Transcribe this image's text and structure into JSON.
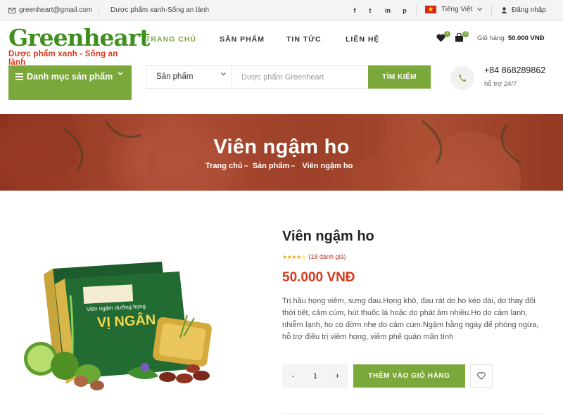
{
  "topbar": {
    "email": "greenheart@gmail.com",
    "slogan": "Dược phẩm xanh-Sống an lành",
    "social": [
      {
        "name": "facebook",
        "glyph": "f"
      },
      {
        "name": "twitter",
        "glyph": "t"
      },
      {
        "name": "linkedin",
        "glyph": "in"
      },
      {
        "name": "pinterest",
        "glyph": "p"
      }
    ],
    "language": "Tiếng Việt",
    "login": "Đăng nhập"
  },
  "logo": {
    "name": "Greenheart",
    "tagline": "Dược phẩm xanh - Sống an lành"
  },
  "nav": {
    "home": "TRANG CHỦ",
    "products": "SẢN PHẨM",
    "news": "TIN TỨC",
    "contact": "LIÊN HỆ"
  },
  "header": {
    "wishlist_count": "1",
    "cart_count": "3",
    "cart_label": "Giỏ hàng:",
    "cart_total": "50.000 VNĐ"
  },
  "category_menu": {
    "label": "Danh mục sản phẩm"
  },
  "search": {
    "category": "Sản phẩm",
    "placeholder": "Dược phẩm Greenheart",
    "button": "TÌM KIẾM"
  },
  "contact": {
    "phone": "+84 868289862",
    "support": "hỗ trợ 24/7"
  },
  "banner": {
    "title": "Viên ngậm ho",
    "breadcrumb": [
      "Trang chủ",
      "–",
      "Sản phẩm",
      "–",
      "Viên ngậm ho"
    ]
  },
  "product": {
    "name": "Viên ngậm ho",
    "rating": 4.5,
    "reviews": "(18 đánh giá)",
    "price": "50.000 VNĐ",
    "description": "Trị hầu họng viêm, sưng đau.Họng khô, đau rát do ho kéo dài, do thay đổi thời tiết, cảm cúm, hút thuốc lá hoặc do phát âm nhiều.Ho do cảm lạnh, nhiễm lạnh, ho có đờm nhẹ do cảm cúm.Ngậm hằng ngày để phòng ngừa, hỗ trợ điều trị viêm họng, viêm phế quản mãn tính",
    "qty_minus": "-",
    "qty_value": "1",
    "qty_plus": "+",
    "add_to_cart": "THÊM VÀO GIỎ HÀNG",
    "box_brand": "VỊ NGÂN",
    "box_line": "Viên ngậm dưỡng họng"
  },
  "colors": {
    "accent": "#7aa83a",
    "price": "#d73a1e",
    "logo": "#3f8f1e"
  }
}
